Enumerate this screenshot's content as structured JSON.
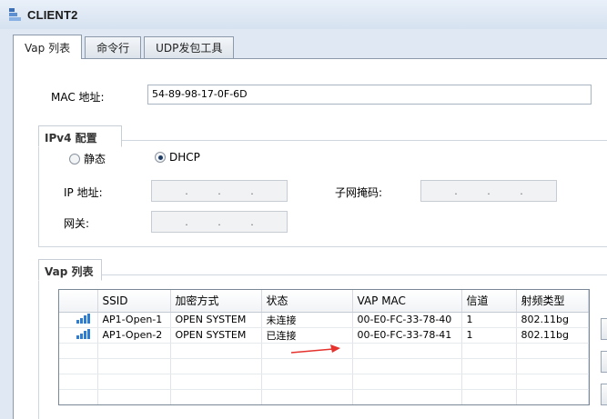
{
  "window": {
    "title": "CLIENT2"
  },
  "tabs": [
    {
      "label": "Vap 列表",
      "active": true
    },
    {
      "label": "命令行",
      "active": false
    },
    {
      "label": "UDP发包工具",
      "active": false
    }
  ],
  "mac": {
    "label": "MAC 地址:",
    "value": "54-89-98-17-0F-6D"
  },
  "ipv4": {
    "group_title": "IPv4 配置",
    "static_label": "静态",
    "dhcp_label": "DHCP",
    "selected": "DHCP",
    "ip_label": "IP 地址:",
    "mask_label": "子网掩码:",
    "gateway_label": "网关:",
    "ip_separator": "."
  },
  "vap": {
    "group_title": "Vap 列表",
    "columns": [
      "",
      "SSID",
      "加密方式",
      "状态",
      "VAP MAC",
      "信道",
      "射频类型"
    ],
    "rows": [
      {
        "ssid": "AP1-Open-1",
        "encryption": "OPEN SYSTEM",
        "status": "未连接",
        "mac": "00-E0-FC-33-78-40",
        "channel": "1",
        "radio": "802.11bg"
      },
      {
        "ssid": "AP1-Open-2",
        "encryption": "OPEN SYSTEM",
        "status": "已连接",
        "mac": "00-E0-FC-33-78-41",
        "channel": "1",
        "radio": "802.11bg"
      }
    ]
  },
  "colors": {
    "accent": "#2e7dd1",
    "annotation_arrow": "#e5322d"
  }
}
